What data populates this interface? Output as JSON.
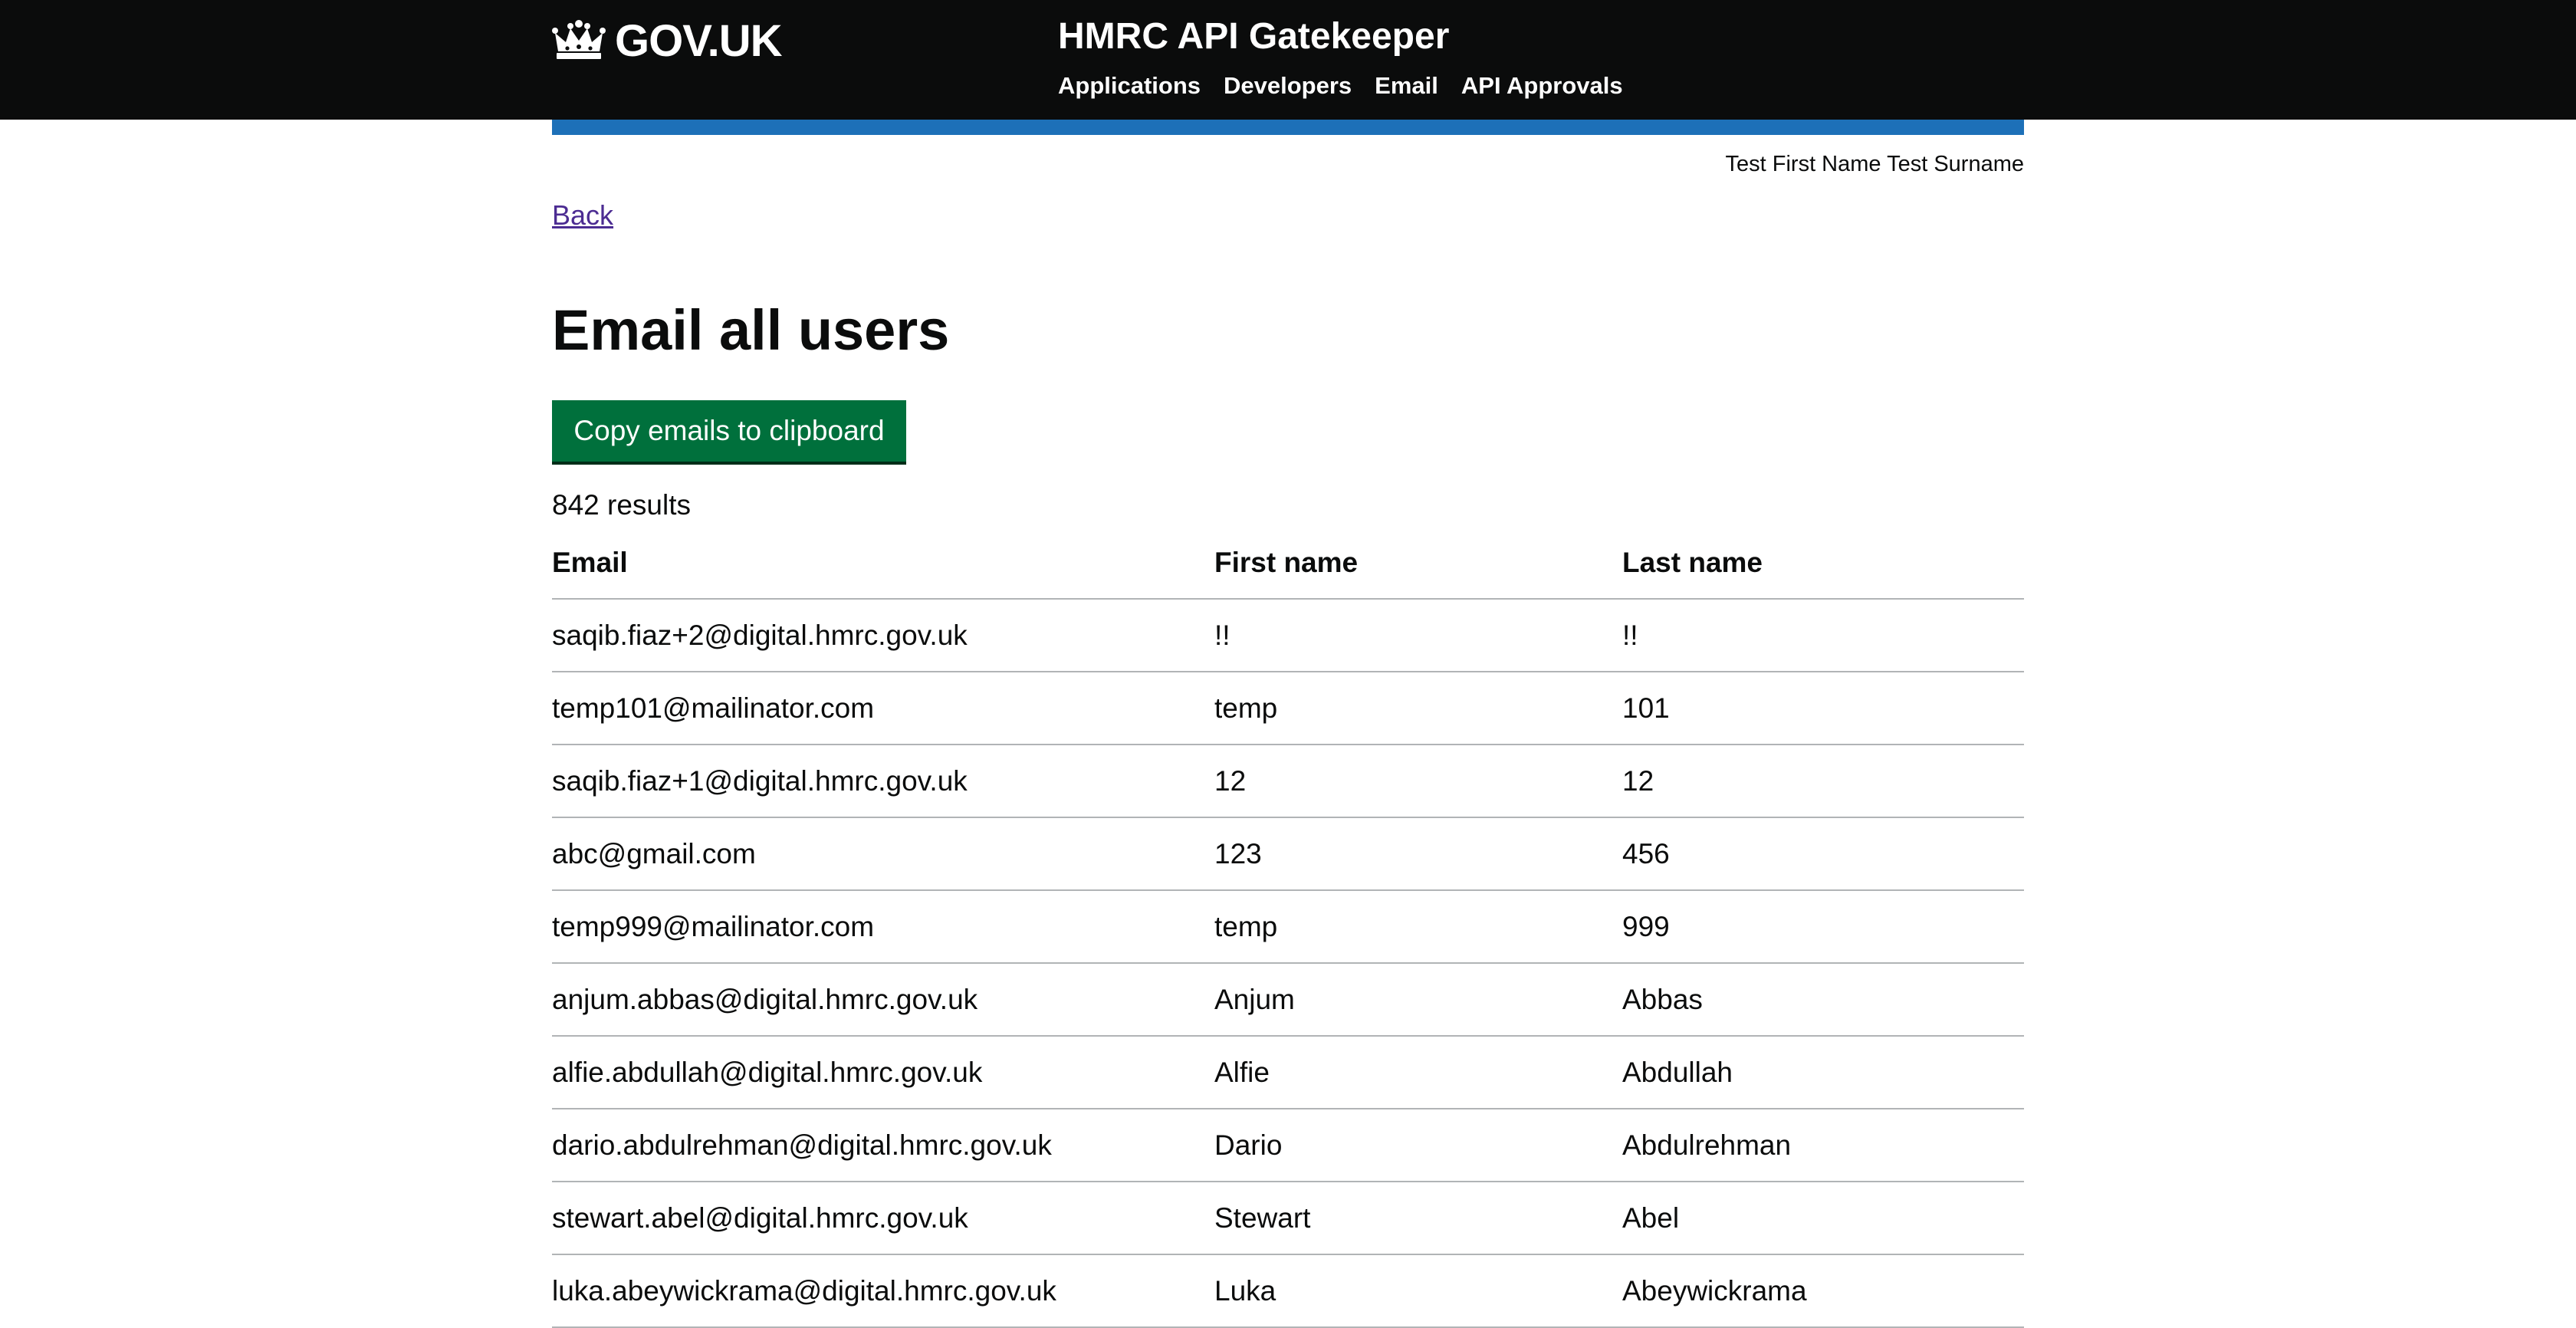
{
  "header": {
    "logo_text": "GOV.UK",
    "service_name": "HMRC API Gatekeeper",
    "nav": [
      "Applications",
      "Developers",
      "Email",
      "API Approvals"
    ]
  },
  "user": {
    "name": "Test First Name Test Surname"
  },
  "back_link": "Back",
  "page_title": "Email all users",
  "copy_button_label": "Copy emails to clipboard",
  "results_count": "842 results",
  "table": {
    "headers": [
      "Email",
      "First name",
      "Last name"
    ],
    "rows": [
      [
        "saqib.fiaz+2@digital.hmrc.gov.uk",
        "!!",
        "!!"
      ],
      [
        "temp101@mailinator.com",
        "temp",
        "101"
      ],
      [
        "saqib.fiaz+1@digital.hmrc.gov.uk",
        "12",
        "12"
      ],
      [
        "abc@gmail.com",
        "123",
        "456"
      ],
      [
        "temp999@mailinator.com",
        "temp",
        "999"
      ],
      [
        "anjum.abbas@digital.hmrc.gov.uk",
        "Anjum",
        "Abbas"
      ],
      [
        "alfie.abdullah@digital.hmrc.gov.uk",
        "Alfie",
        "Abdullah"
      ],
      [
        "dario.abdulrehman@digital.hmrc.gov.uk",
        "Dario",
        "Abdulrehman"
      ],
      [
        "stewart.abel@digital.hmrc.gov.uk",
        "Stewart",
        "Abel"
      ],
      [
        "luka.abeywickrama@digital.hmrc.gov.uk",
        "Luka",
        "Abeywickrama"
      ]
    ]
  },
  "colors": {
    "header_bg": "#0b0c0c",
    "accent_bar": "#1d70b8",
    "button_green": "#00703c",
    "link_visited": "#4c2c92"
  },
  "icons": {
    "logo": "crown-icon"
  }
}
